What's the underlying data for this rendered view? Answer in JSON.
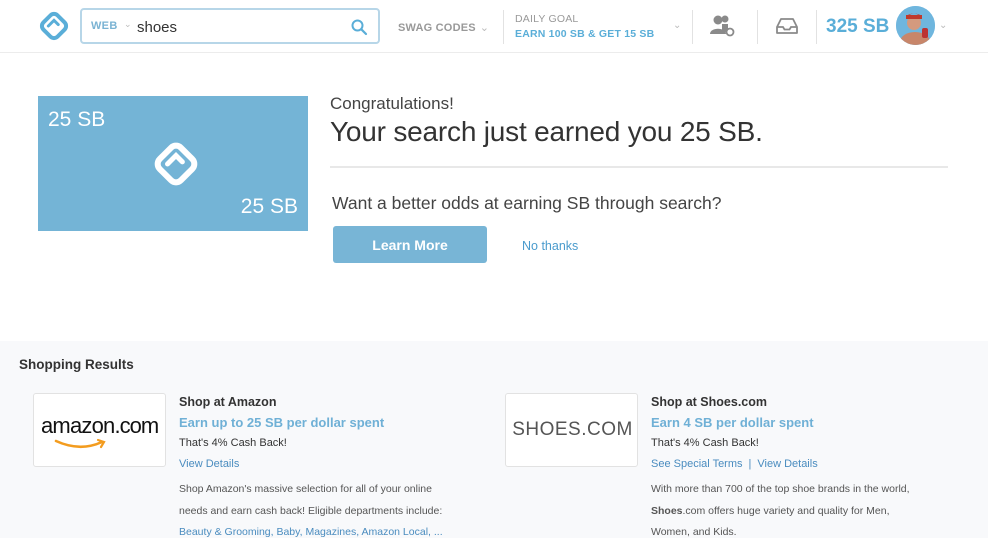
{
  "header": {
    "search": {
      "scope_label": "WEB",
      "query": "shoes"
    },
    "swag_codes_label": "SWAG CODES",
    "daily_goal": {
      "label": "DAILY GOAL",
      "value": "EARN 100 SB & GET 15 SB"
    },
    "balance": "325 SB",
    "icons": {
      "logo": "swagbucks-logo-icon",
      "search": "search-icon",
      "friends": "friends-icon",
      "inbox": "inbox-icon",
      "avatar": "user-avatar"
    }
  },
  "reward": {
    "card_top_left": "25 SB",
    "card_bottom_right": "25 SB",
    "congrats": "Congratulations!",
    "headline": "Your search just earned you 25 SB.",
    "question": "Want a better odds at earning SB through search?",
    "learn_more_label": "Learn More",
    "no_thanks_label": "No thanks"
  },
  "shopping": {
    "title": "Shopping Results",
    "merchants": [
      {
        "logo_text": "amazon",
        "logo_suffix": ".com",
        "name": "Shop at Amazon",
        "earn": "Earn up to 25 SB per dollar spent",
        "cash_back": "That's 4% Cash Back!",
        "link_primary": "View Details",
        "desc_line1": "Shop Amazon's massive selection for all of your online",
        "desc_line2": "needs and earn cash back! Eligible departments include:",
        "desc_links": "Beauty & Grooming, Baby, Magazines, Amazon Local, ..."
      },
      {
        "logo_text": "SHOES.COM",
        "name": "Shop at Shoes.com",
        "earn": "Earn 4 SB per dollar spent",
        "cash_back": "That's 4% Cash Back!",
        "link_terms": "See Special Terms",
        "link_separator": "|",
        "link_primary": "View Details",
        "desc_line1": "With more than 700 of the top shoe brands in the world,",
        "desc_line2_bold": "Shoes",
        "desc_line2": ".com offers huge variety and quality for Men,",
        "desc_line3": "Women, and Kids."
      }
    ]
  },
  "colors": {
    "accent": "#5aaed8",
    "card_bg": "#74b4d6",
    "button_bg": "#78b5d6",
    "link": "#4a8cbf"
  }
}
